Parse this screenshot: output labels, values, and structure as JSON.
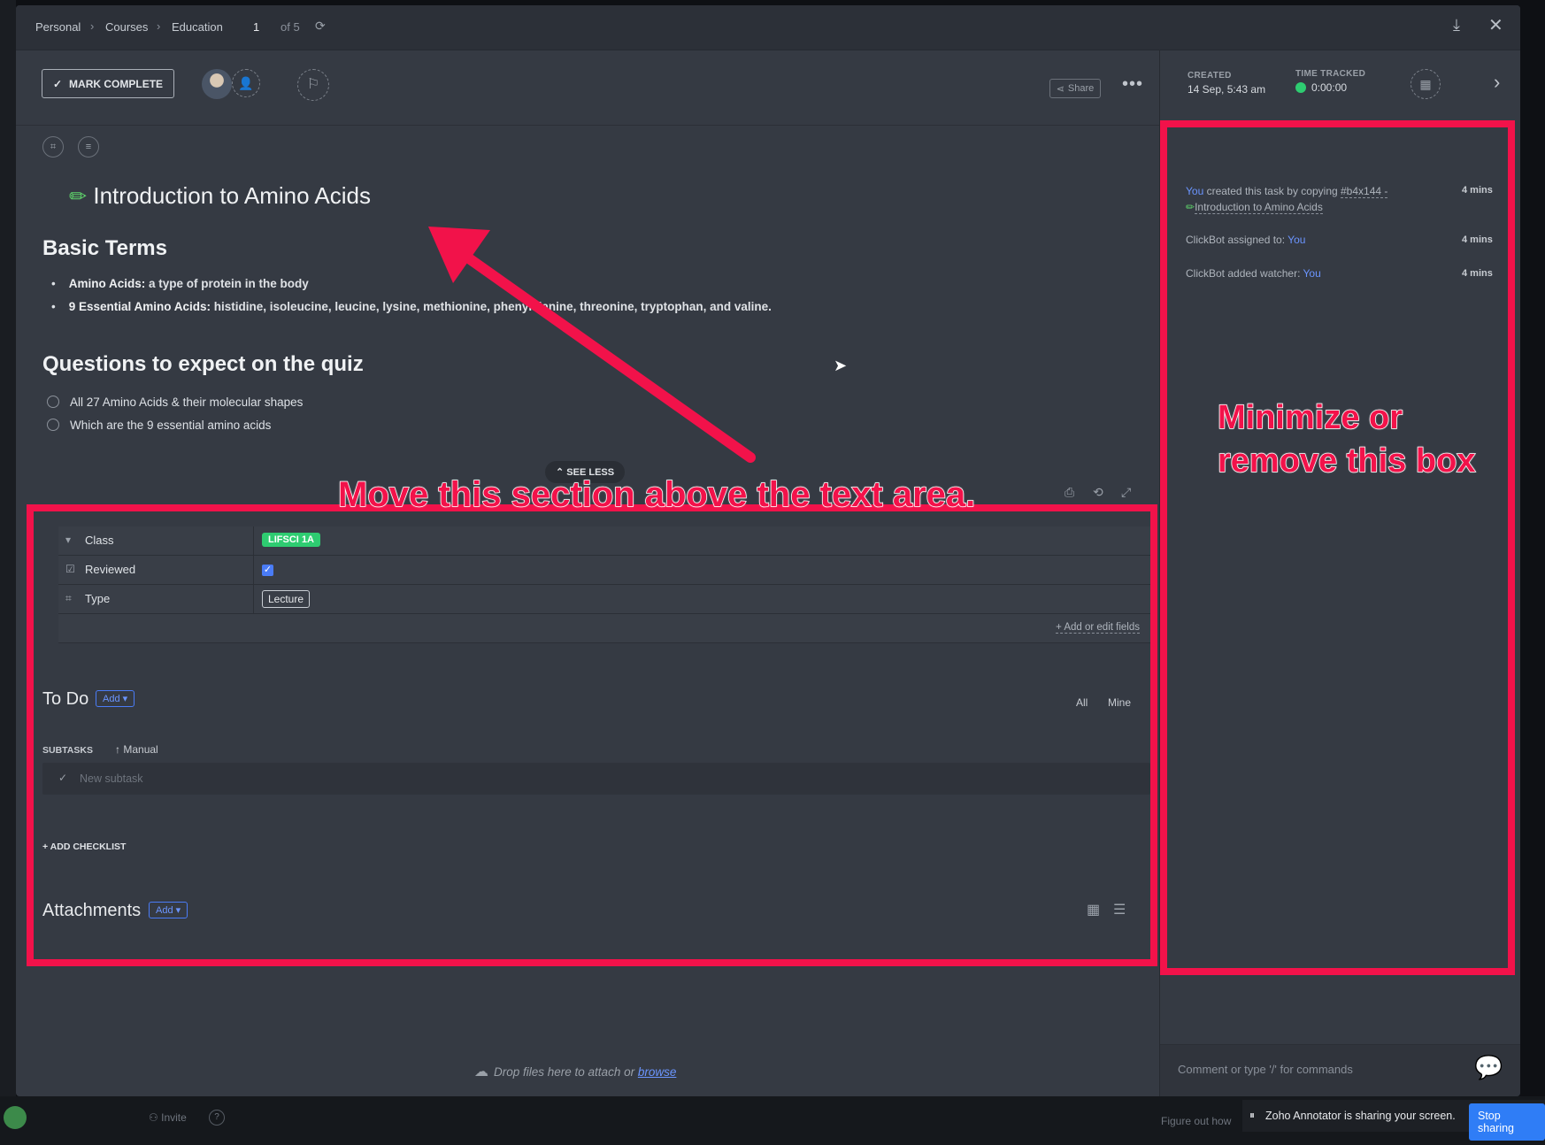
{
  "breadcrumb": {
    "items": [
      "Personal",
      "Courses",
      "Education"
    ],
    "page_current": "1",
    "page_total": "of 5"
  },
  "toolbar": {
    "mark_complete": "MARK COMPLETE",
    "share": "Share"
  },
  "meta": {
    "created_label": "CREATED",
    "created_value": "14 Sep, 5:43 am",
    "time_label": "TIME TRACKED",
    "time_value": "0:00:00"
  },
  "task": {
    "title": "Introduction to Amino Acids"
  },
  "content": {
    "section1_heading": "Basic Terms",
    "bullet1_bold": "Amino Acids:",
    "bullet1_text": " a type of protein in the body",
    "bullet2_bold": "9 Essential Amino Acids:",
    "bullet2_text": " histidine, isoleucine, leucine, lysine, methionine, phenylalanine, threonine, tryptophan, and valine.",
    "section2_heading": "Questions to expect on the quiz",
    "quiz_items": [
      "All 27 Amino Acids & their molecular shapes",
      "Which are the 9 essential amino acids"
    ],
    "see_less": "SEE LESS"
  },
  "fields": {
    "class_label": "Class",
    "class_value": "LIFSCI 1A",
    "reviewed_label": "Reviewed",
    "type_label": "Type",
    "type_value": "Lecture",
    "add_edit": "+ Add or edit fields"
  },
  "todo": {
    "heading": "To Do",
    "add": "Add",
    "filter_all": "All",
    "filter_mine": "Mine",
    "subtasks_label": "SUBTASKS",
    "sort_label": "Manual",
    "new_subtask_placeholder": "New subtask",
    "add_checklist": "+ ADD CHECKLIST"
  },
  "attachments": {
    "heading": "Attachments",
    "add": "Add",
    "drop_text": "Drop files here to attach or ",
    "browse": "browse"
  },
  "activity": {
    "items": [
      {
        "actor": "You",
        "text": " created this task by copying ",
        "ref": "#b4x144 -",
        "ref2": "Introduction to Amino Acids",
        "time": "4 mins"
      },
      {
        "text": "ClickBot assigned to: ",
        "target": "You",
        "time": "4 mins"
      },
      {
        "text": "ClickBot added watcher: ",
        "target": "You",
        "time": "4 mins"
      }
    ],
    "comment_placeholder": "Comment or type '/' for commands"
  },
  "annotations": {
    "move_text": "Move this section above the text area.",
    "minimize_line1": "Minimize or",
    "minimize_line2": "remove this box",
    "color": "#f2124a"
  },
  "bottom": {
    "invite": "Invite",
    "figure_out": "Figure out how",
    "sharing_text": "Zoho Annotator is sharing your screen.",
    "stop_sharing": "Stop sharing"
  }
}
